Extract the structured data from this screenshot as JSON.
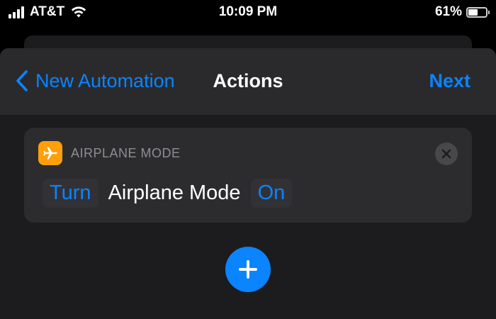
{
  "status_bar": {
    "carrier": "AT&T",
    "time": "10:09 PM",
    "battery_percent": "61%",
    "battery_level": 0.61,
    "signal_bars": 4
  },
  "nav": {
    "back_label": "New Automation",
    "title": "Actions",
    "next_label": "Next"
  },
  "action": {
    "name": "AIRPLANE MODE",
    "verb": "Turn",
    "subject": "Airplane Mode",
    "state": "On",
    "icon": "airplane-icon"
  },
  "colors": {
    "accent": "#0a84ff",
    "app_icon": "#ff9f0a",
    "background": "#000000",
    "sheet": "#1c1c1e",
    "card": "#2c2c2e"
  }
}
